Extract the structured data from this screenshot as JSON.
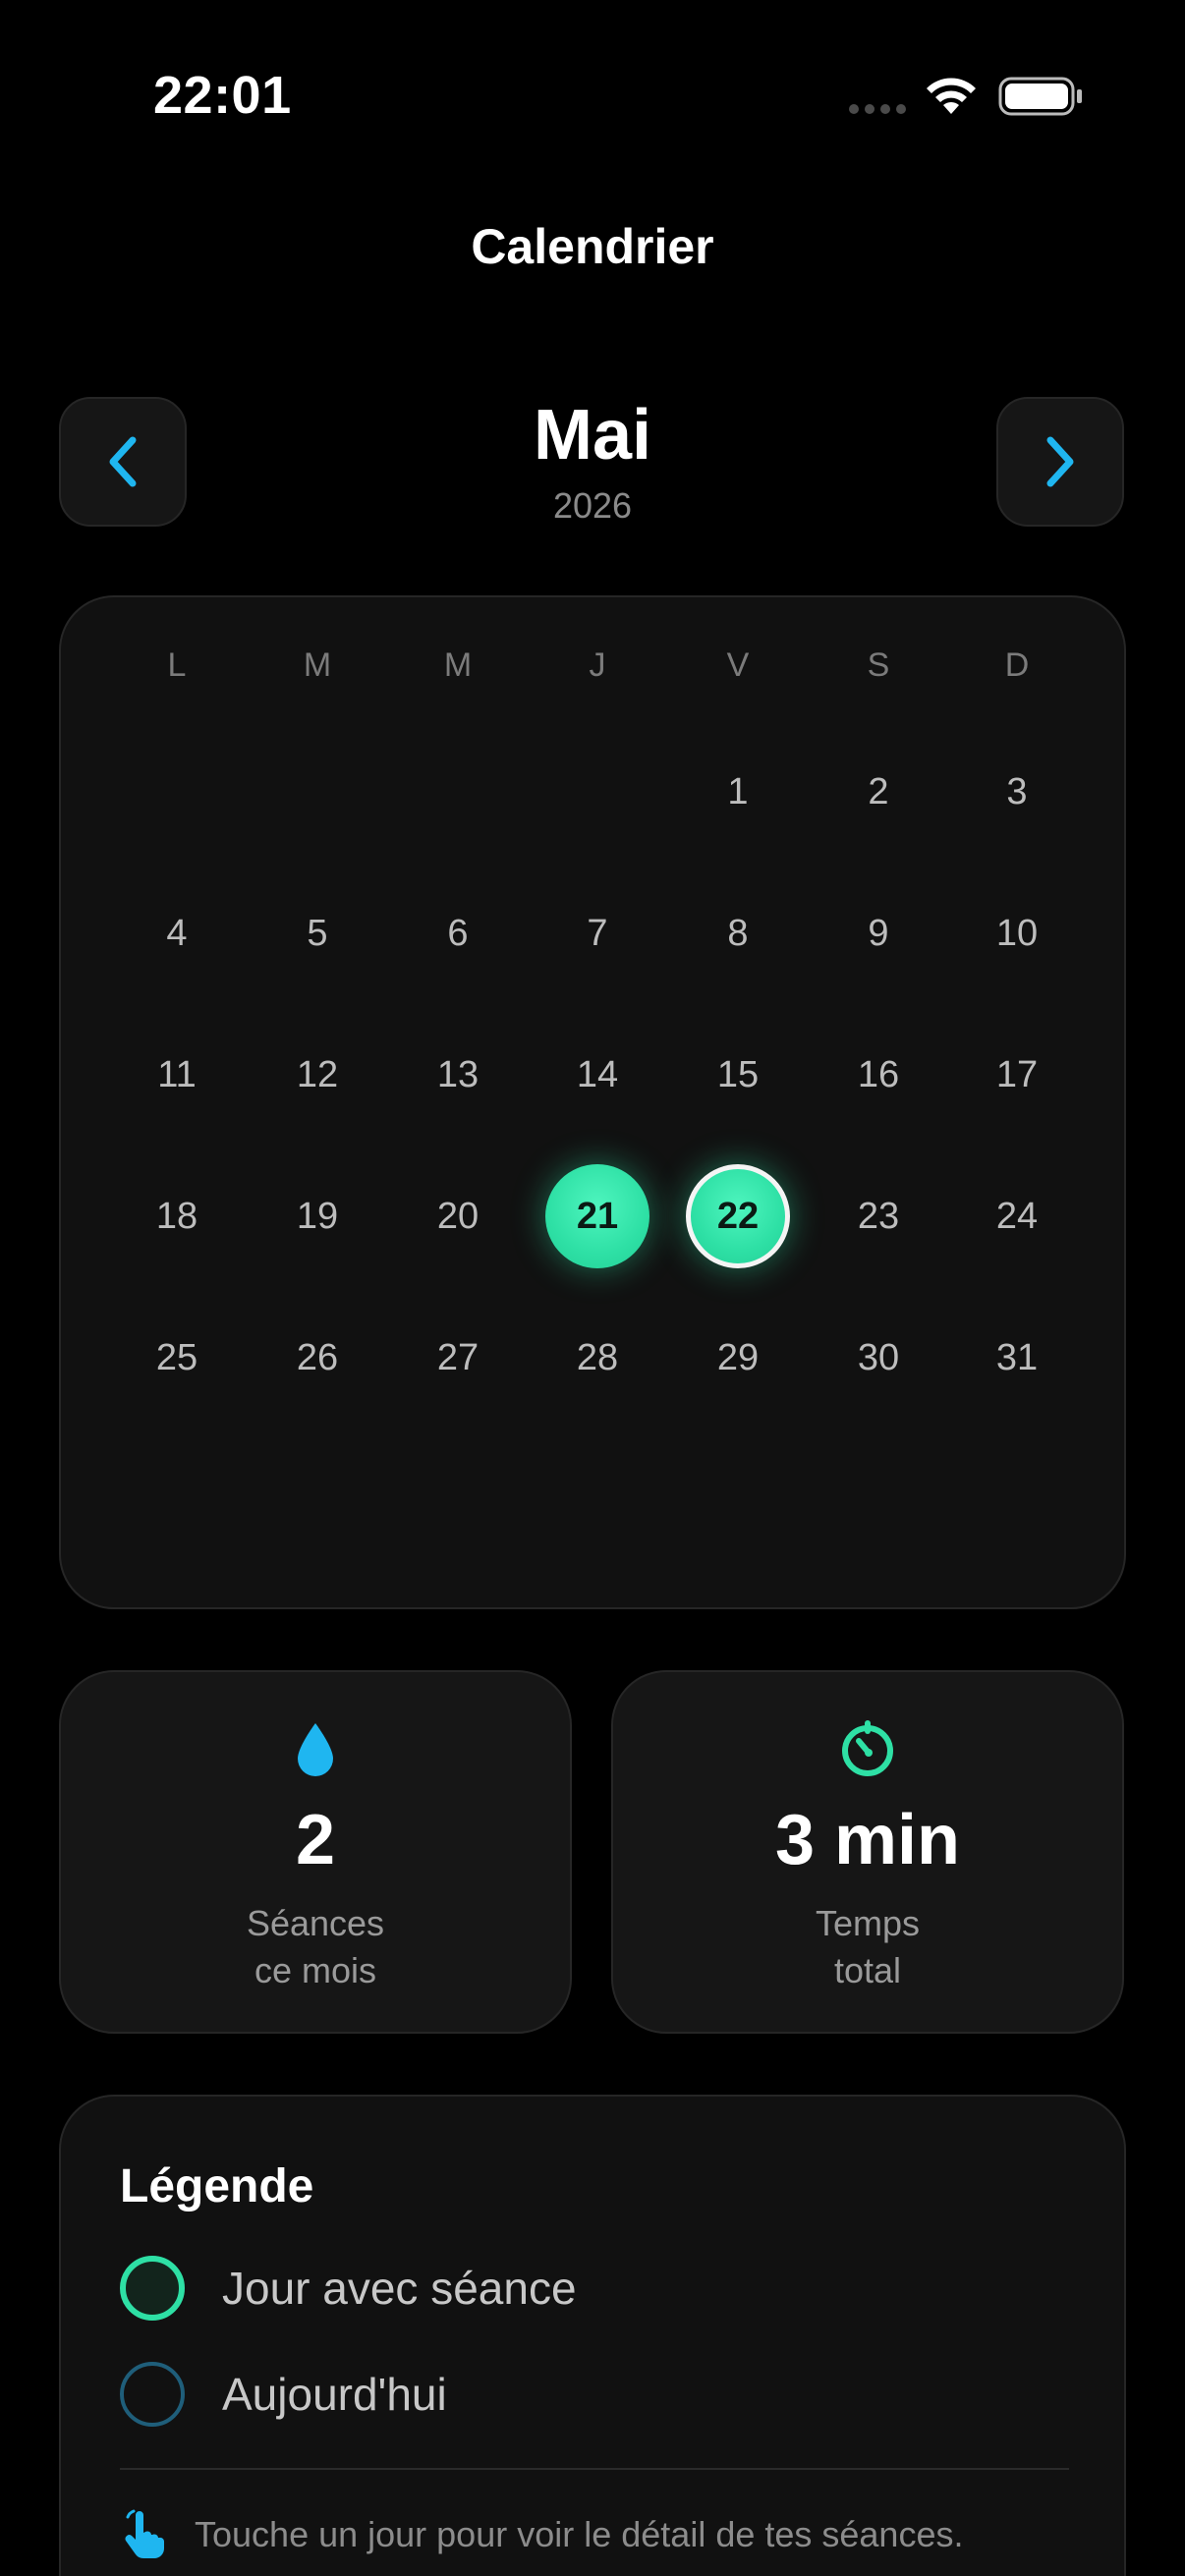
{
  "status_bar": {
    "time": "22:01"
  },
  "header": {
    "title": "Calendrier"
  },
  "month_nav": {
    "month": "Mai",
    "year": "2026",
    "prev_icon": "chevron-left-icon",
    "next_icon": "chevron-right-icon",
    "accent_color": "#1fb6f0"
  },
  "calendar": {
    "weekdays": [
      "L",
      "M",
      "M",
      "J",
      "V",
      "S",
      "D"
    ],
    "first_weekday_index": 4,
    "days_in_month": 31,
    "session_days": [
      21,
      22
    ],
    "today": 22,
    "session_color": "#2ee0a5"
  },
  "stats": {
    "sessions": {
      "icon": "drop-icon",
      "value": "2",
      "label_line1": "Séances",
      "label_line2": "ce mois"
    },
    "time": {
      "icon": "timer-icon",
      "value": "3 min",
      "label_line1": "Temps",
      "label_line2": "total"
    }
  },
  "legend": {
    "title": "Légende",
    "session_label": "Jour avec séance",
    "today_label": "Aujourd'hui",
    "hint_icon": "tap-hand-icon",
    "hint": "Touche un jour pour voir le détail de tes séances."
  }
}
